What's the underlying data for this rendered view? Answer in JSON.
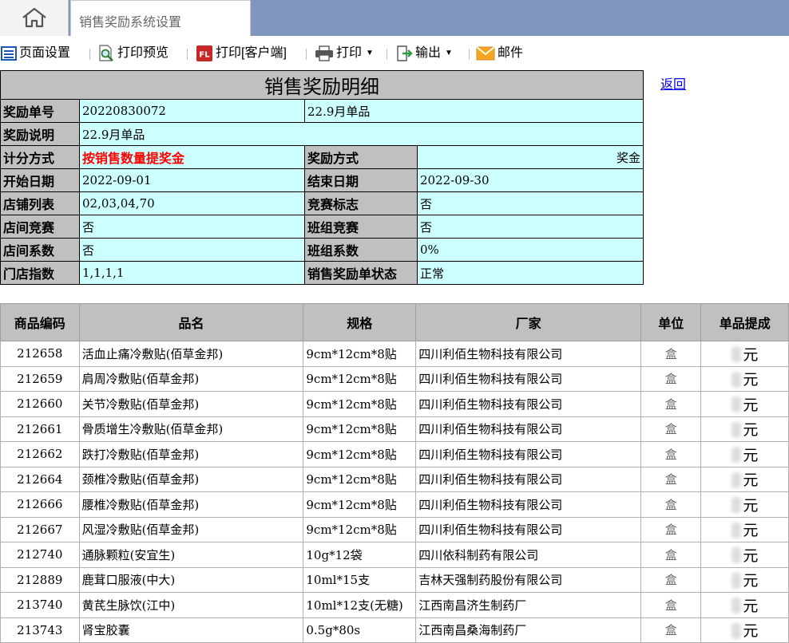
{
  "tabs": {
    "home_icon": "home-icon",
    "active_tab_label": "销售奖励系统设置"
  },
  "toolbar": {
    "page_setup": "页面设置",
    "print_preview": "打印预览",
    "print_client": "打印[客户端]",
    "print": "打印",
    "export": "输出",
    "mail": "邮件"
  },
  "back_link": "返回",
  "detail": {
    "title": "销售奖励明细",
    "labels": {
      "reward_no": "奖励单号",
      "reward_desc": "奖励说明",
      "calc_method": "计分方式",
      "reward_method": "奖励方式",
      "start_date": "开始日期",
      "end_date": "结束日期",
      "store_list": "店铺列表",
      "competition_flag": "竞赛标志",
      "store_competition": "店间竞赛",
      "team_competition": "班组竞赛",
      "store_coef": "店间系数",
      "team_coef": "班组系数",
      "store_index": "门店指数",
      "status": "销售奖励单状态"
    },
    "values": {
      "reward_no": "20220830072",
      "reward_no_note": "22.9月单品",
      "reward_desc": "22.9月单品",
      "calc_method": "按销售数量提奖金",
      "reward_method": "奖金",
      "start_date": "2022-09-01",
      "end_date": "2022-09-30",
      "store_list": "02,03,04,70",
      "competition_flag": "否",
      "store_competition": "否",
      "team_competition": "否",
      "store_coef": "否",
      "team_coef": "0%",
      "store_index": "1,1,1,1",
      "status": "正常"
    }
  },
  "items": {
    "headers": {
      "code": "商品编码",
      "name": "品名",
      "spec": "规格",
      "maker": "厂家",
      "unit": "单位",
      "commission": "单品提成"
    },
    "rows": [
      {
        "code": "212658",
        "name": "活血止痛冷敷贴(佰草金邦)",
        "spec": "9cm*12cm*8贴",
        "maker": "四川利佰生物科技有限公司",
        "unit": "盒",
        "commission": "元"
      },
      {
        "code": "212659",
        "name": "肩周冷敷贴(佰草金邦)",
        "spec": "9cm*12cm*8贴",
        "maker": "四川利佰生物科技有限公司",
        "unit": "盒",
        "commission": "元"
      },
      {
        "code": "212660",
        "name": "关节冷敷贴(佰草金邦)",
        "spec": "9cm*12cm*8贴",
        "maker": "四川利佰生物科技有限公司",
        "unit": "盒",
        "commission": "元"
      },
      {
        "code": "212661",
        "name": "骨质增生冷敷贴(佰草金邦)",
        "spec": "9cm*12cm*8贴",
        "maker": "四川利佰生物科技有限公司",
        "unit": "盒",
        "commission": "元"
      },
      {
        "code": "212662",
        "name": "跌打冷敷贴(佰草金邦)",
        "spec": "9cm*12cm*8贴",
        "maker": "四川利佰生物科技有限公司",
        "unit": "盒",
        "commission": "元"
      },
      {
        "code": "212664",
        "name": "颈椎冷敷贴(佰草金邦)",
        "spec": "9cm*12cm*8贴",
        "maker": "四川利佰生物科技有限公司",
        "unit": "盒",
        "commission": "元"
      },
      {
        "code": "212666",
        "name": "腰椎冷敷贴(佰草金邦)",
        "spec": "9cm*12cm*8贴",
        "maker": "四川利佰生物科技有限公司",
        "unit": "盒",
        "commission": "元"
      },
      {
        "code": "212667",
        "name": "风湿冷敷贴(佰草金邦)",
        "spec": "9cm*12cm*8贴",
        "maker": "四川利佰生物科技有限公司",
        "unit": "盒",
        "commission": "元"
      },
      {
        "code": "212740",
        "name": "通脉颗粒(安宜生)",
        "spec": "10g*12袋",
        "maker": "四川依科制药有限公司",
        "unit": "盒",
        "commission": "元"
      },
      {
        "code": "212889",
        "name": "鹿茸口服液(中大)",
        "spec": "10ml*15支",
        "maker": "吉林天强制药股份有限公司",
        "unit": "盒",
        "commission": "元"
      },
      {
        "code": "213740",
        "name": "黄芪生脉饮(江中)",
        "spec": "10ml*12支(无糖)",
        "maker": "江西南昌济生制药厂",
        "unit": "盒",
        "commission": "元"
      },
      {
        "code": "213743",
        "name": "肾宝胶囊",
        "spec": "0.5g*80s",
        "maker": "江西南昌桑海制药厂",
        "unit": "盒",
        "commission": "元"
      }
    ]
  }
}
